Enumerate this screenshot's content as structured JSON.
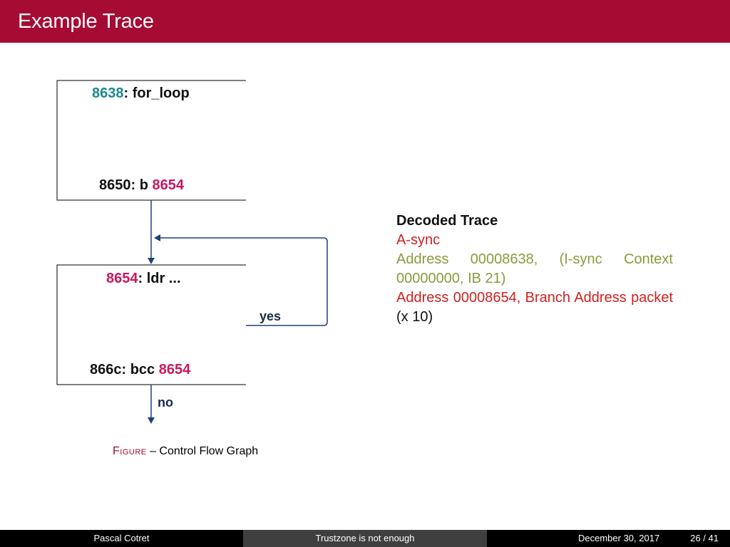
{
  "slide": {
    "title": "Example Trace"
  },
  "cfg": {
    "block1": {
      "top_addr": "8638",
      "top_label": ": for_loop",
      "bottom_text": "8650: b ",
      "bottom_target": "8654"
    },
    "block2": {
      "top_addr": "8654",
      "top_label": ": ldr ...",
      "bottom_text": "866c: bcc ",
      "bottom_target": "8654"
    },
    "edge_yes": "yes",
    "edge_no": "no",
    "caption_prefix": "Figure",
    "caption_text": " – Control Flow Graph"
  },
  "trace": {
    "heading": "Decoded Trace",
    "line1": "A-sync",
    "line2": "Address 00008638, (I-sync Context 00000000, IB 21)",
    "line3": "Address 00008654, Branch Address packet",
    "line3_suffix": " (x 10)"
  },
  "footer": {
    "author": "Pascal Cotret",
    "talk_title": "Trustzone is not enough",
    "date": "December 30, 2017",
    "page": "26 / 41"
  },
  "colors": {
    "title_bar": "#a50b33",
    "teal_address": "#17898f",
    "magenta_address": "#c8185d",
    "trace_red": "#d1201f",
    "trace_olive": "#8a9a3b"
  }
}
